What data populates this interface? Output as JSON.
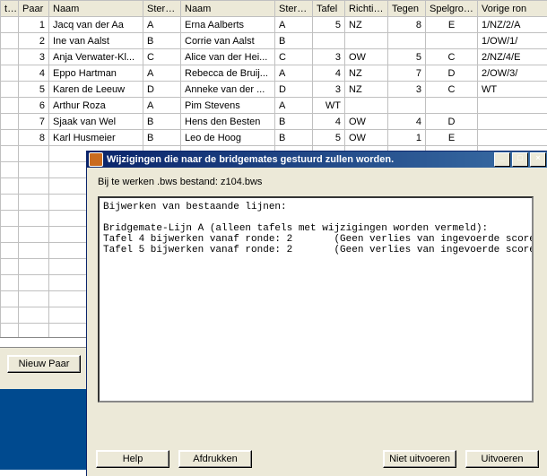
{
  "grid": {
    "headers": [
      "tief",
      "Paar",
      "Naam",
      "Sterkte",
      "Naam",
      "Sterkte",
      "Tafel",
      "Richting",
      "Tegen",
      "Spelgroep",
      "Vorige ron"
    ],
    "rows": [
      {
        "paar": "1",
        "naam1": "Jacq van der Aa",
        "str1": "A",
        "naam2": "Erna Aalberts",
        "str2": "A",
        "tafel": "5",
        "richting": "NZ",
        "tegen": "8",
        "spelgroep": "E",
        "vorige": "1/NZ/2/A"
      },
      {
        "paar": "2",
        "naam1": "Ine van Aalst",
        "str1": "B",
        "naam2": "Corrie van Aalst",
        "str2": "B",
        "tafel": "",
        "richting": "",
        "tegen": "",
        "spelgroep": "",
        "vorige": "1/OW/1/"
      },
      {
        "paar": "3",
        "naam1": "Anja Verwater-Kl...",
        "str1": "C",
        "naam2": "Alice van der Hei...",
        "str2": "C",
        "tafel": "3",
        "richting": "OW",
        "tegen": "5",
        "spelgroep": "C",
        "vorige": "2/NZ/4/E"
      },
      {
        "paar": "4",
        "naam1": "Eppo Hartman",
        "str1": "A",
        "naam2": "Rebecca de Bruij...",
        "str2": "A",
        "tafel": "4",
        "richting": "NZ",
        "tegen": "7",
        "spelgroep": "D",
        "vorige": "2/OW/3/"
      },
      {
        "paar": "5",
        "naam1": "Karen de Leeuw",
        "str1": "D",
        "naam2": "Anneke van der ...",
        "str2": "D",
        "tafel": "3",
        "richting": "NZ",
        "tegen": "3",
        "spelgroep": "C",
        "vorige": "WT"
      },
      {
        "paar": "6",
        "naam1": "Arthur Roza",
        "str1": "A",
        "naam2": "Pim Stevens",
        "str2": "A",
        "tafel": "WT",
        "richting": "",
        "tegen": "",
        "spelgroep": "",
        "vorige": ""
      },
      {
        "paar": "7",
        "naam1": "Sjaak van Wel",
        "str1": "B",
        "naam2": "Hens den Besten",
        "str2": "B",
        "tafel": "4",
        "richting": "OW",
        "tegen": "4",
        "spelgroep": "D",
        "vorige": ""
      },
      {
        "paar": "8",
        "naam1": "Karl Husmeier",
        "str1": "B",
        "naam2": "Leo de Hoog",
        "str2": "B",
        "tafel": "5",
        "richting": "OW",
        "tegen": "1",
        "spelgroep": "E",
        "vorige": ""
      }
    ]
  },
  "buttons": {
    "nieuwPaar": "Nieuw Paar"
  },
  "dialog": {
    "title": "Wijzigingen die naar de bridgemates gestuurd zullen worden.",
    "fileLabel": "Bij te werken .bws bestand: z104.bws",
    "content": "Bijwerken van bestaande lijnen:\n\nBridgemate-Lijn A (alleen tafels met wijzigingen worden vermeld):\nTafel 4 bijwerken vanaf ronde: 2       (Geen verlies van ingevoerde scores)\nTafel 5 bijwerken vanaf ronde: 2       (Geen verlies van ingevoerde scores)",
    "btnHelp": "Help",
    "btnPrint": "Afdrukken",
    "btnCancel": "Niet uitvoeren",
    "btnExecute": "Uitvoeren"
  }
}
